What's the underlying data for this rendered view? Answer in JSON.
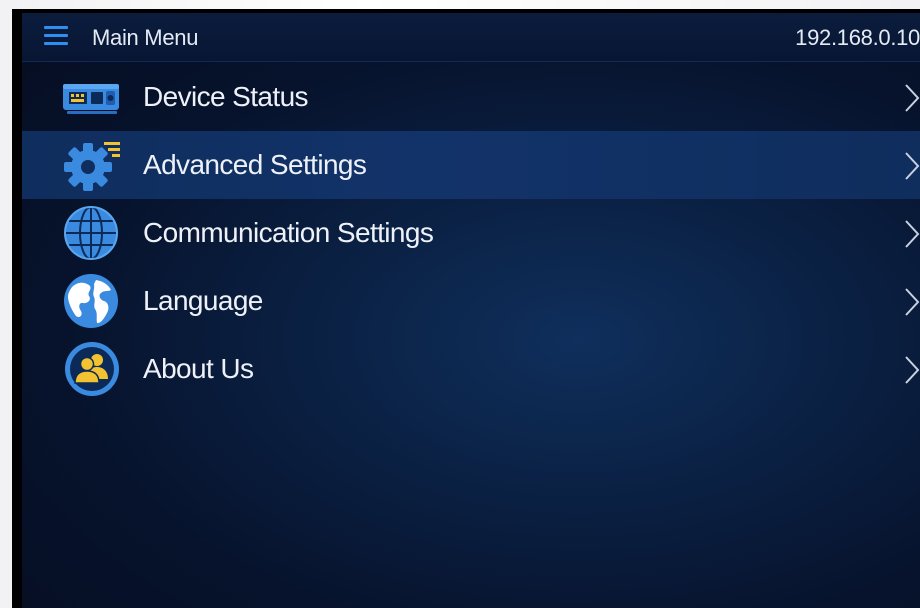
{
  "header": {
    "menu_icon": "hamburger-menu-icon",
    "title": "Main Menu",
    "ip_address": "192.168.0.10"
  },
  "menu": {
    "items": [
      {
        "label": "Device Status",
        "icon": "device-status-icon",
        "selected": false
      },
      {
        "label": "Advanced Settings",
        "icon": "gear-icon",
        "selected": true
      },
      {
        "label": "Communication Settings",
        "icon": "globe-grid-icon",
        "selected": false
      },
      {
        "label": "Language",
        "icon": "earth-icon",
        "selected": false
      },
      {
        "label": "About Us",
        "icon": "users-icon",
        "selected": false
      }
    ],
    "chevron_icon": "chevron-right-icon"
  },
  "colors": {
    "background": "#07132d",
    "header": "#0b1c3d",
    "selected_row": "#12336a",
    "accent": "#2f8ef2",
    "icon_blue": "#3a8be0",
    "icon_yellow": "#f2c230",
    "text": "#eef2f8"
  }
}
